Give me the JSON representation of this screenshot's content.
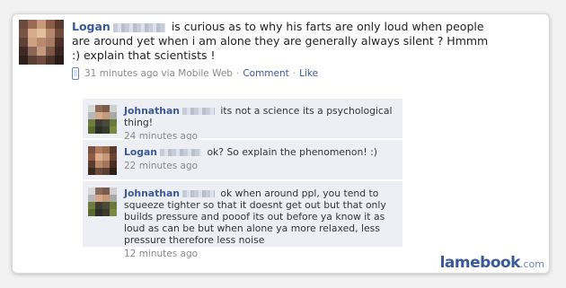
{
  "post": {
    "author": "Logan",
    "text": "is curious as to why his farts are only loud when people are around yet when i am alone they are generally always silent ? Hmmm :) explain that scientists !",
    "time": "31 minutes ago via Mobile Web",
    "comment_link": "Comment",
    "like_link": "Like",
    "separator": "·"
  },
  "comments": [
    {
      "author": "Johnathan",
      "text": "its not a science its a psychological thing!",
      "time": "24 minutes ago"
    },
    {
      "author": "Logan",
      "text": "ok? So explain the phenomenon! :)",
      "time": "22 minutes ago"
    },
    {
      "author": "Johnathan",
      "text": "ok when around ppl, you tend to squeeze tighter so that it doesnt get out but that only builds pressure and pooof its out before ya know it as loud as can be but when alone ya more relaxed, less pressure therefore less noise",
      "time": "12 minutes ago"
    }
  ],
  "watermark": {
    "brand": "lamebook",
    "tld": ".com"
  },
  "colors": {
    "link": "#3b5998",
    "comment_bg": "#edeff4",
    "meta": "#8a8a8a"
  },
  "icons": {
    "mobile": "mobile-phone-icon"
  }
}
